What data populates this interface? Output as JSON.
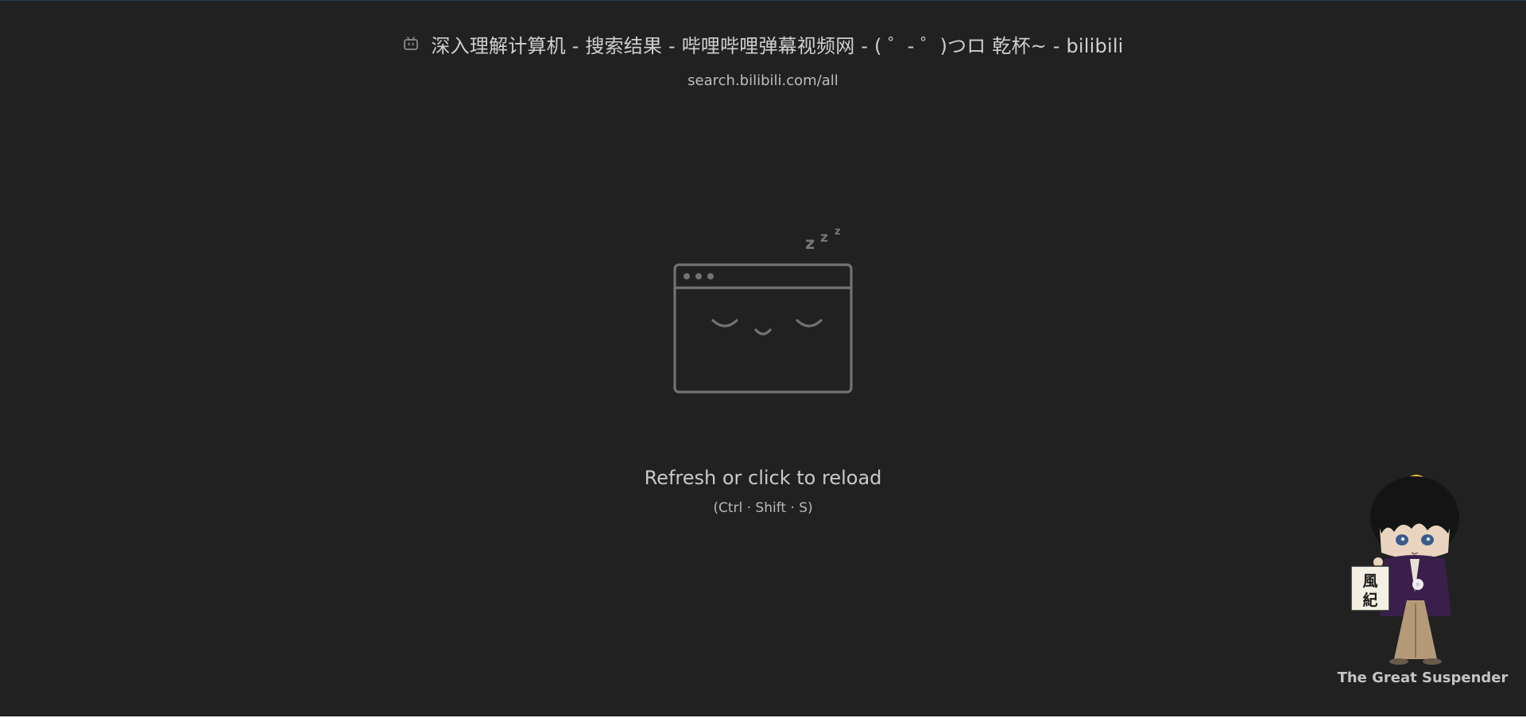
{
  "page": {
    "title": "深入理解计算机 - 搜索结果 - 哔哩哔哩弹幕视频网 - ( ゜- ゜)つロ 乾杯~ - bilibili",
    "url": "search.bilibili.com/all",
    "favicon_icon": "bilibili-tv-icon"
  },
  "suspended": {
    "illustration_icon": "sleeping-browser-window-icon",
    "sleep_text": "z z z",
    "reload_text": "Refresh or click to reload",
    "shortcut": "(Ctrl · Shift · S)"
  },
  "branding": {
    "mascot_icon": "suspender-mascot-icon",
    "mascot_sign": "風紀",
    "name": "The Great Suspender"
  },
  "colors": {
    "background": "#212121",
    "text": "#c8c8c8",
    "illustration_stroke": "#727272"
  }
}
